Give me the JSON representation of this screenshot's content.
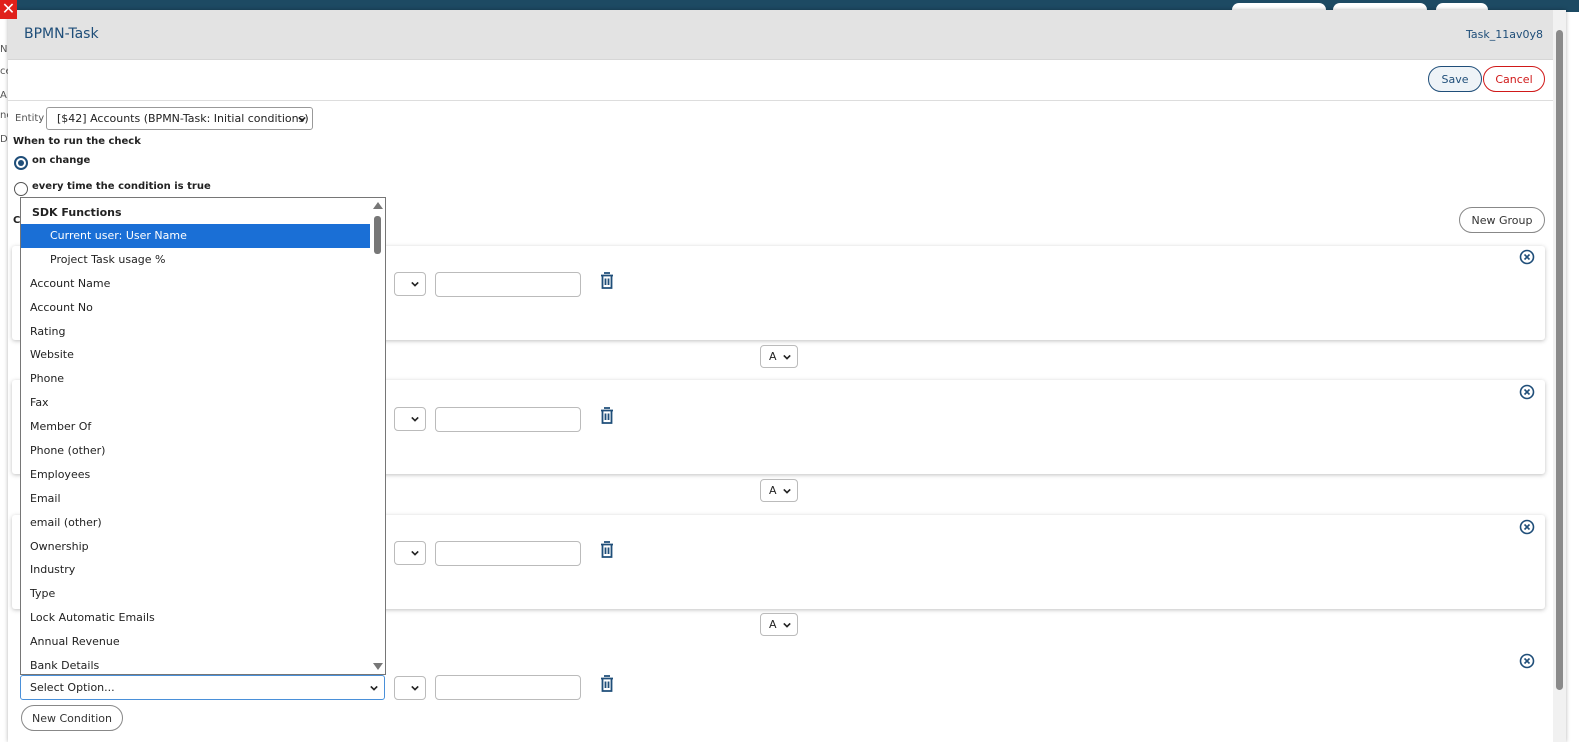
{
  "window": {
    "close_glyph": "✕"
  },
  "background_stub": [
    "N",
    "ce",
    "A",
    "nc",
    "D"
  ],
  "modal": {
    "title": "BPMN-Task",
    "task_id": "Task_11av0y8",
    "save_label": "Save",
    "cancel_label": "Cancel"
  },
  "entity": {
    "label": "Entity",
    "selected": "[$42] Accounts (BPMN-Task: Initial conditions)"
  },
  "when": {
    "label": "When to run the check",
    "options": [
      {
        "label": "on change",
        "checked": true
      },
      {
        "label": "every time the condition is true",
        "checked": false
      }
    ]
  },
  "conditions_label_cut": "C",
  "new_group_label": "New Group",
  "join_operator": "A",
  "field_select_placeholder": "Select Option...",
  "new_condition_label": "New Condition",
  "dropdown": {
    "group_label": "SDK Functions",
    "sdk_items": [
      "Current user: User Name",
      "Project Task usage %"
    ],
    "selected_index": 0,
    "fields": [
      "Account Name",
      "Account No",
      "Rating",
      "Website",
      "Phone",
      "Fax",
      "Member Of",
      "Phone (other)",
      "Employees",
      "Email",
      "email (other)",
      "Ownership",
      "Industry",
      "Type",
      "Lock Automatic Emails",
      "Annual Revenue",
      "Bank Details"
    ]
  },
  "colors": {
    "brand": "#1f4e79",
    "cancel": "#d01919",
    "selection": "#1a6fd6",
    "header_bg": "#e3e3e3",
    "close_red": "#e0201a"
  }
}
